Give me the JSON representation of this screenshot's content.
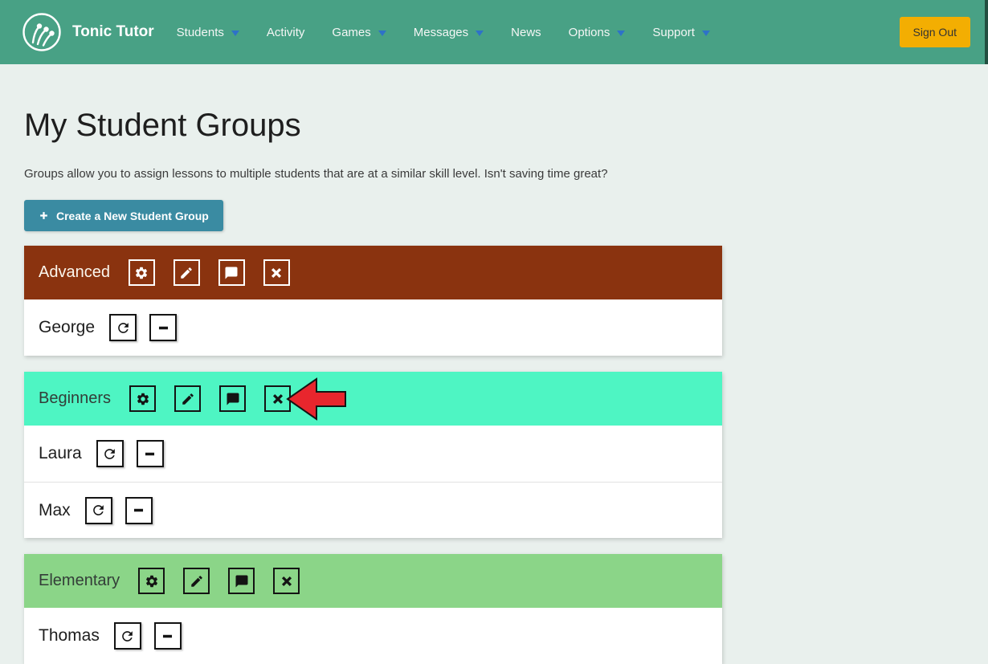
{
  "navbar": {
    "brand": "Tonic Tutor",
    "items": [
      {
        "label": "Students",
        "caret": true
      },
      {
        "label": "Activity",
        "caret": false
      },
      {
        "label": "Games",
        "caret": true
      },
      {
        "label": "Messages",
        "caret": true
      },
      {
        "label": "News",
        "caret": false
      },
      {
        "label": "Options",
        "caret": true
      },
      {
        "label": "Support",
        "caret": true
      }
    ],
    "sign_out_label": "Sign Out"
  },
  "page": {
    "title": "My Student Groups",
    "description": "Groups allow you to assign lessons to multiple students that are at a similar skill level. Isn't saving time great?",
    "create_button_label": "Create a New Student Group"
  },
  "groups": [
    {
      "name": "Advanced",
      "theme": "dark-red",
      "students": [
        "George"
      ]
    },
    {
      "name": "Beginners",
      "theme": "mint",
      "students": [
        "Laura",
        "Max"
      ],
      "annotation": {
        "type": "red-arrow",
        "points_at": "delete-group-button",
        "color": "#e8262d"
      }
    },
    {
      "name": "Elementary",
      "theme": "green",
      "students": [
        "Thomas"
      ]
    }
  ],
  "icons": {
    "group_actions": [
      "gear",
      "pencil",
      "comment",
      "close"
    ],
    "student_actions": [
      "refresh",
      "remove"
    ]
  },
  "colors": {
    "navbar_green": "#48a185",
    "page_background": "#e9f0ed",
    "sign_out_yellow": "#f3ae02",
    "create_button_teal": "#3a8ba2",
    "advanced_header": "#8a330f",
    "beginners_header": "#4ef5c3",
    "elementary_header": "#8bd588",
    "caret_blue": "#2e72c8",
    "annotation_red": "#e8262d"
  }
}
